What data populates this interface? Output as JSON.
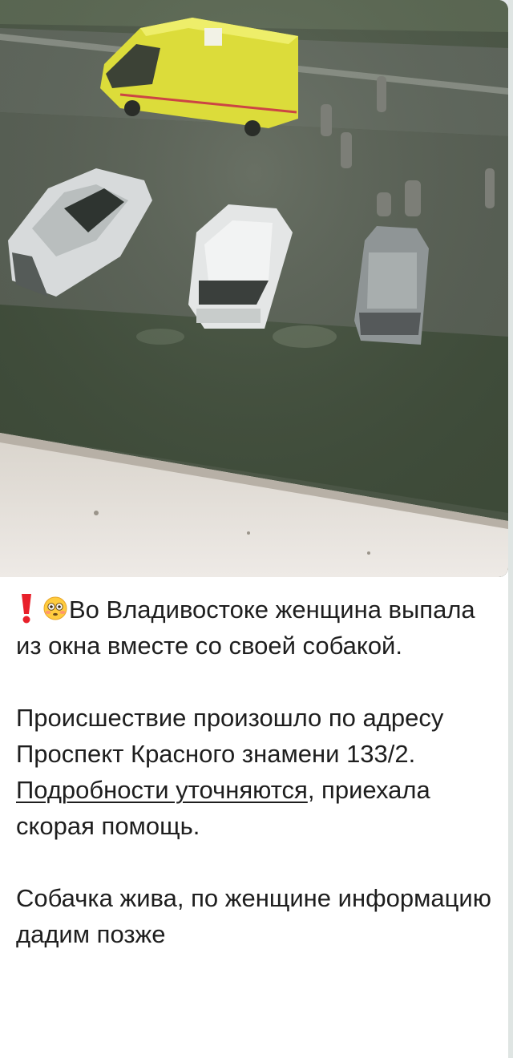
{
  "post": {
    "line1_text": "Во Владивостоке женщина выпала из окна вместе со своей собакой.",
    "para2_text": "Происшествие произошло по адресу Проспект Красного знамени 133/2.",
    "link_text": "Подробности уточняются",
    "after_link_text": ", приехала скорая помощь.",
    "para3_text": "Собачка жива, по женщине информацию дадим позже",
    "emojis": [
      "exclamation-icon",
      "flushed-face-icon"
    ]
  },
  "colors": {
    "text": "#1e1e1e",
    "ambulance": "#e3e236",
    "grass": "#3d4a38",
    "background": "#e3e7ea"
  }
}
